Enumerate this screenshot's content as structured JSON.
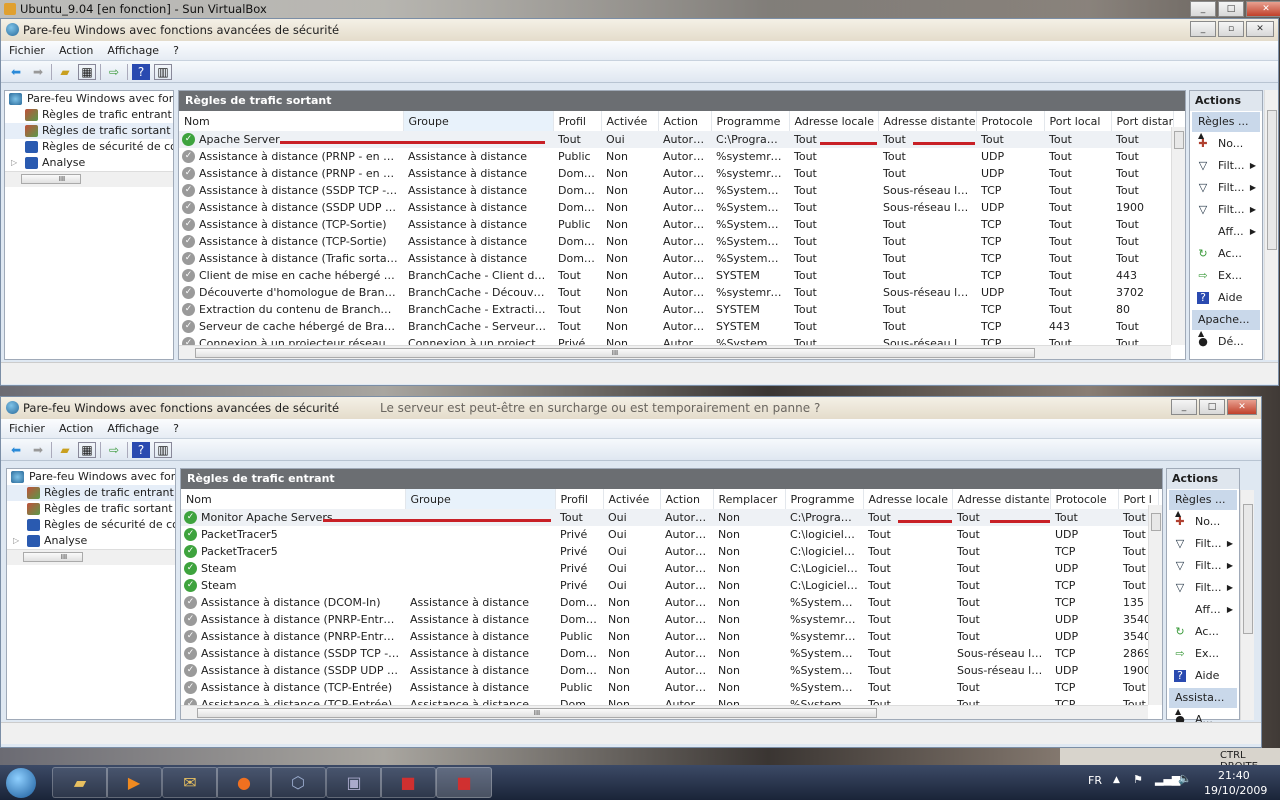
{
  "vbox_title": "Ubuntu_9.04 [en fonction] - Sun VirtualBox",
  "bg_text": "Le serveur est peut-être en surcharge ou est temporairement en panne ?",
  "menu": [
    "Fichier",
    "Action",
    "Affichage",
    "?"
  ],
  "tree": {
    "root": "Pare-feu Windows avec fonctio",
    "items": [
      "Règles de trafic entrant",
      "Règles de trafic sortant",
      "Règles de sécurité de conne",
      "Analyse"
    ]
  },
  "window_title": "Pare-feu Windows avec fonctions avancées de sécurité",
  "top": {
    "panel_title": "Règles de trafic sortant",
    "columns": [
      "Nom",
      "Groupe",
      "Profil",
      "Activée",
      "Action",
      "Programme",
      "Adresse locale",
      "Adresse distante",
      "Protocole",
      "Port local",
      "Port distant"
    ],
    "rows": [
      [
        "Apache Server",
        "",
        "Tout",
        "Oui",
        "Autoriser",
        "C:\\Program ...",
        "Tout",
        "Tout",
        "Tout",
        "Tout",
        "Tout"
      ],
      [
        "Assistance à distance (PRNP - en sortie)",
        "Assistance à distance",
        "Public",
        "Non",
        "Autoriser",
        "%systemroo...",
        "Tout",
        "Tout",
        "UDP",
        "Tout",
        "Tout"
      ],
      [
        "Assistance à distance (PRNP - en sortie)",
        "Assistance à distance",
        "Doma...",
        "Non",
        "Autoriser",
        "%systemroo...",
        "Tout",
        "Tout",
        "UDP",
        "Tout",
        "Tout"
      ],
      [
        "Assistance à distance (SSDP TCP - en sort...",
        "Assistance à distance",
        "Doma...",
        "Non",
        "Autoriser",
        "%SystemRo...",
        "Tout",
        "Sous-réseau local",
        "TCP",
        "Tout",
        "Tout"
      ],
      [
        "Assistance à distance (SSDP UDP - en sor...",
        "Assistance à distance",
        "Doma...",
        "Non",
        "Autoriser",
        "%SystemRo...",
        "Tout",
        "Sous-réseau local",
        "UDP",
        "Tout",
        "1900"
      ],
      [
        "Assistance à distance (TCP-Sortie)",
        "Assistance à distance",
        "Public",
        "Non",
        "Autoriser",
        "%SystemRo...",
        "Tout",
        "Tout",
        "TCP",
        "Tout",
        "Tout"
      ],
      [
        "Assistance à distance (TCP-Sortie)",
        "Assistance à distance",
        "Doma...",
        "Non",
        "Autoriser",
        "%SystemRo...",
        "Tout",
        "Tout",
        "TCP",
        "Tout",
        "Tout"
      ],
      [
        "Assistance à distance (Trafic sortant TCP ...",
        "Assistance à distance",
        "Doma...",
        "Non",
        "Autoriser",
        "%SystemRo...",
        "Tout",
        "Tout",
        "TCP",
        "Tout",
        "Tout"
      ],
      [
        "Client de mise en cache hébergé de Bran...",
        "BranchCache - Client de mi...",
        "Tout",
        "Non",
        "Autoriser",
        "SYSTEM",
        "Tout",
        "Tout",
        "TCP",
        "Tout",
        "443"
      ],
      [
        "Découverte d'homologue de BranchCac...",
        "BranchCache - Découverte ...",
        "Tout",
        "Non",
        "Autoriser",
        "%systemroo...",
        "Tout",
        "Sous-réseau local",
        "UDP",
        "Tout",
        "3702"
      ],
      [
        "Extraction du contenu de BranchCache (...",
        "BranchCache - Extraction d...",
        "Tout",
        "Non",
        "Autoriser",
        "SYSTEM",
        "Tout",
        "Tout",
        "TCP",
        "Tout",
        "80"
      ],
      [
        "Serveur de cache hébergé de BranchCac...",
        "BranchCache - Serveur de c...",
        "Tout",
        "Non",
        "Autoriser",
        "SYSTEM",
        "Tout",
        "Tout",
        "TCP",
        "443",
        "Tout"
      ],
      [
        "Connexion à un projecteur réseau (TCP-S...",
        "Connexion à un projecteur ...",
        "Privé",
        "Non",
        "Autoriser",
        "%SystemRo...",
        "Tout",
        "Sous-réseau local",
        "TCP",
        "Tout",
        "Tout"
      ]
    ],
    "enabled_rows": 1,
    "actions": {
      "title": "Actions",
      "group1": "Règles ...",
      "items": [
        [
          "No...",
          "new-rule-icon",
          false
        ],
        [
          "Filt...",
          "filter-icon",
          true
        ],
        [
          "Filt...",
          "filter-icon",
          true
        ],
        [
          "Filt...",
          "filter-icon",
          true
        ],
        [
          "Aff...",
          "",
          true
        ],
        [
          "Ac...",
          "refresh-icon",
          false
        ],
        [
          "Ex...",
          "export-icon",
          false
        ],
        [
          "Aide",
          "help-icon",
          false
        ]
      ],
      "group2": "Apache...",
      "group2_items": [
        "Dé..."
      ]
    }
  },
  "bottom": {
    "panel_title": "Règles de trafic entrant",
    "columns": [
      "Nom",
      "Groupe",
      "Profil",
      "Activée",
      "Action",
      "Remplacer",
      "Programme",
      "Adresse locale",
      "Adresse distante",
      "Protocole",
      "Port l"
    ],
    "rows": [
      [
        "Monitor Apache Servers",
        "",
        "Tout",
        "Oui",
        "Autoriser",
        "Non",
        "C:\\Program ...",
        "Tout",
        "Tout",
        "Tout",
        "Tout"
      ],
      [
        "PacketTracer5",
        "",
        "Privé",
        "Oui",
        "Autoriser",
        "Non",
        "C:\\logiciels\\...",
        "Tout",
        "Tout",
        "UDP",
        "Tout"
      ],
      [
        "PacketTracer5",
        "",
        "Privé",
        "Oui",
        "Autoriser",
        "Non",
        "C:\\logiciels\\...",
        "Tout",
        "Tout",
        "TCP",
        "Tout"
      ],
      [
        "Steam",
        "",
        "Privé",
        "Oui",
        "Autoriser",
        "Non",
        "C:\\Logiciels\\...",
        "Tout",
        "Tout",
        "UDP",
        "Tout"
      ],
      [
        "Steam",
        "",
        "Privé",
        "Oui",
        "Autoriser",
        "Non",
        "C:\\Logiciels\\...",
        "Tout",
        "Tout",
        "TCP",
        "Tout"
      ],
      [
        "Assistance à distance (DCOM-In)",
        "Assistance à distance",
        "Doma...",
        "Non",
        "Autoriser",
        "Non",
        "%SystemRo...",
        "Tout",
        "Tout",
        "TCP",
        "135"
      ],
      [
        "Assistance à distance (PNRP-Entrant)",
        "Assistance à distance",
        "Doma...",
        "Non",
        "Autoriser",
        "Non",
        "%systemroo...",
        "Tout",
        "Tout",
        "UDP",
        "3540"
      ],
      [
        "Assistance à distance (PNRP-Entrant)",
        "Assistance à distance",
        "Public",
        "Non",
        "Autoriser",
        "Non",
        "%systemroo...",
        "Tout",
        "Tout",
        "UDP",
        "3540"
      ],
      [
        "Assistance à distance (SSDP TCP - en ent...",
        "Assistance à distance",
        "Doma...",
        "Non",
        "Autoriser",
        "Non",
        "%SystemRo...",
        "Tout",
        "Sous-réseau local",
        "TCP",
        "2869"
      ],
      [
        "Assistance à distance (SSDP UDP - en ent...",
        "Assistance à distance",
        "Doma...",
        "Non",
        "Autoriser",
        "Non",
        "%SystemRo...",
        "Tout",
        "Sous-réseau local",
        "UDP",
        "1900"
      ],
      [
        "Assistance à distance (TCP-Entrée)",
        "Assistance à distance",
        "Public",
        "Non",
        "Autoriser",
        "Non",
        "%SystemRo...",
        "Tout",
        "Tout",
        "TCP",
        "Tout"
      ],
      [
        "Assistance à distance (TCP-Entrée)",
        "Assistance à distance",
        "Doma...",
        "Non",
        "Autoriser",
        "Non",
        "%SystemRo...",
        "Tout",
        "Tout",
        "TCP",
        "Tout"
      ]
    ],
    "enabled_rows": 5,
    "actions": {
      "title": "Actions",
      "group1": "Règles ...",
      "items": [
        [
          "No...",
          "new-rule-icon",
          false
        ],
        [
          "Filt...",
          "filter-icon",
          true
        ],
        [
          "Filt...",
          "filter-icon",
          true
        ],
        [
          "Filt...",
          "filter-icon",
          true
        ],
        [
          "Aff...",
          "",
          true
        ],
        [
          "Ac...",
          "refresh-icon",
          false
        ],
        [
          "Ex...",
          "export-icon",
          false
        ],
        [
          "Aide",
          "help-icon",
          false
        ]
      ],
      "group2": "Assista...",
      "group2_items": [
        "A..."
      ]
    }
  },
  "vbox_status": "CTRL DROITE",
  "tray": {
    "lang": "FR",
    "time": "21:40",
    "date": "19/10/2009"
  },
  "colors": {
    "annotation_red": "#c82026",
    "panel_header": "#6b6e72",
    "enabled_green": "#3ea33e"
  }
}
